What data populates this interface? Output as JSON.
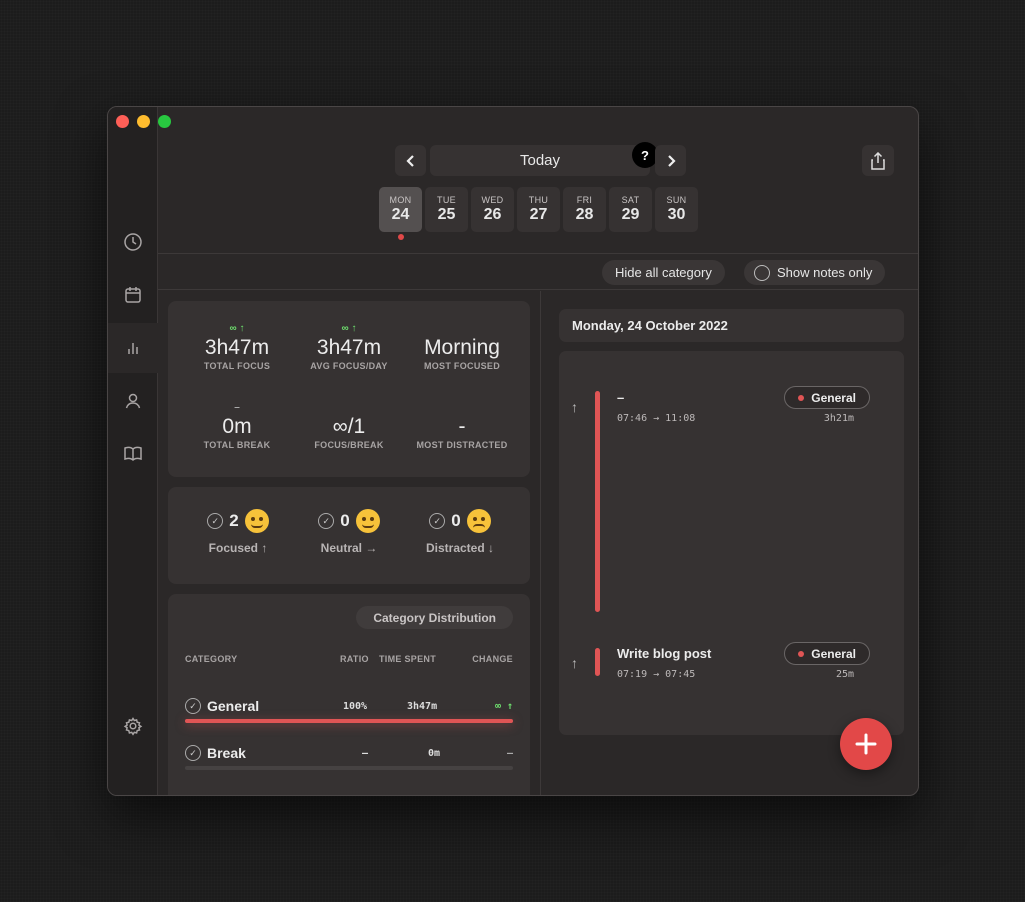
{
  "nav": {
    "today_label": "Today",
    "help_label": "?",
    "days": [
      {
        "name": "MON",
        "date": "24",
        "active": true
      },
      {
        "name": "TUE",
        "date": "25"
      },
      {
        "name": "WED",
        "date": "26"
      },
      {
        "name": "THU",
        "date": "27"
      },
      {
        "name": "FRI",
        "date": "28"
      },
      {
        "name": "SAT",
        "date": "29"
      },
      {
        "name": "SUN",
        "date": "30"
      }
    ]
  },
  "sidebar": {
    "items": [
      {
        "icon": "clock-icon"
      },
      {
        "icon": "calendar-icon"
      },
      {
        "icon": "bar-chart-icon",
        "active": true
      },
      {
        "icon": "person-icon"
      },
      {
        "icon": "book-icon"
      },
      {
        "icon": "gear-icon"
      }
    ]
  },
  "filters": {
    "hide_all": "Hide all category",
    "show_notes": "Show notes only"
  },
  "stats": {
    "total_focus": {
      "trend": "∞ ↑",
      "value": "3h47m",
      "label": "TOTAL FOCUS"
    },
    "avg_focus": {
      "trend": "∞ ↑",
      "value": "3h47m",
      "label": "AVG FOCUS/DAY"
    },
    "most_focused": {
      "value": "Morning",
      "label": "MOST FOCUSED"
    },
    "total_break": {
      "trend": "–",
      "value": "0m",
      "label": "TOTAL BREAK"
    },
    "focus_break": {
      "value": "∞/1",
      "label": "FOCUS/BREAK"
    },
    "most_distracted": {
      "value": "-",
      "label": "MOST DISTRACTED"
    }
  },
  "moods": {
    "focused": {
      "count": "2",
      "label": "Focused ↑"
    },
    "neutral": {
      "count": "0",
      "label": "Neutral →"
    },
    "distracted": {
      "count": "0",
      "label": "Distracted ↓"
    }
  },
  "categories": {
    "title": "Category Distribution",
    "headers": {
      "category": "CATEGORY",
      "ratio": "RATIO",
      "time": "TIME SPENT",
      "change": "CHANGE"
    },
    "rows": [
      {
        "name": "General",
        "ratio": "100%",
        "time": "3h47m",
        "change": "∞ ↑",
        "fill": 1.0
      },
      {
        "name": "Break",
        "ratio": "–",
        "time": "0m",
        "change": "–",
        "fill": 0.0
      }
    ]
  },
  "timeline": {
    "date": "Monday, 24 October 2022",
    "entries": [
      {
        "title": "–",
        "time": "07:46 → 11:08",
        "tag": "General",
        "duration": "3h21m"
      },
      {
        "title": "Write blog post",
        "time": "07:19 → 07:45",
        "tag": "General",
        "duration": "25m"
      }
    ]
  },
  "colors": {
    "accent": "#e05555",
    "trend_up": "#6ee06e",
    "background": "#2b2828"
  }
}
